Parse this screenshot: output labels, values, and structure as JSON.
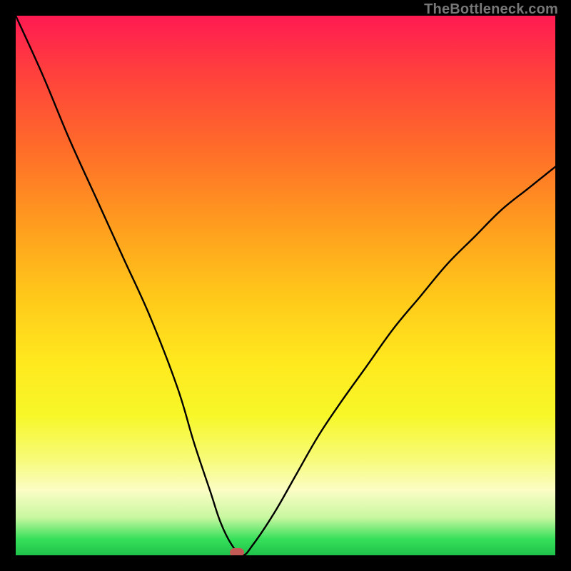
{
  "watermark": "TheBottleneck.com",
  "colors": {
    "marker": "#c45a56",
    "curve": "#000000",
    "frame": "#000000"
  },
  "chart_data": {
    "type": "line",
    "title": "",
    "xlabel": "",
    "ylabel": "",
    "xlim": [
      0,
      100
    ],
    "ylim": [
      0,
      100
    ],
    "series": [
      {
        "name": "bottleneck-curve",
        "x": [
          0,
          5,
          10,
          15,
          20,
          25,
          30,
          33,
          36,
          38,
          40,
          42,
          44,
          48,
          52,
          56,
          60,
          65,
          70,
          75,
          80,
          85,
          90,
          95,
          100
        ],
        "values": [
          100,
          89,
          77,
          66,
          55,
          44,
          31,
          21,
          12,
          6,
          2,
          0,
          2,
          8,
          15,
          22,
          28,
          35,
          42,
          48,
          54,
          59,
          64,
          68,
          72
        ]
      }
    ],
    "marker": {
      "x": 41,
      "y": 0
    },
    "grid": false,
    "legend": false,
    "background_gradient": {
      "top": "#ff1a52",
      "mid": "#ffe81e",
      "bottom": "#1fc24a"
    }
  }
}
